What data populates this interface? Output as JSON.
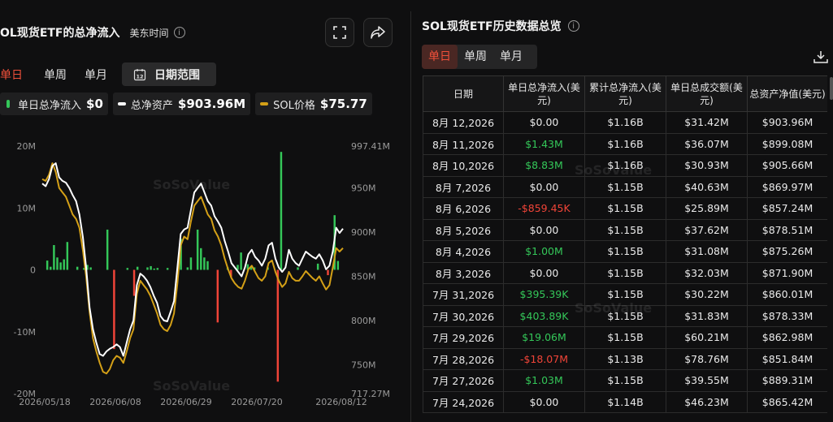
{
  "left": {
    "title": "OL现货ETF的总净流入",
    "timezone": "美东时间",
    "tabs": [
      "单日",
      "单周",
      "单月"
    ],
    "date_range_label": "日期范围",
    "date_range_icon_text": "12",
    "legend": [
      {
        "label": "单日总净流入",
        "value": "$0",
        "color": "#34c759"
      },
      {
        "label": "总净资产",
        "value": "$903.96M",
        "color": "#ffffff"
      },
      {
        "label": "SOL价格",
        "value": "$75.77",
        "color": "#d4a017"
      }
    ]
  },
  "right": {
    "title": "SOL现货ETF历史数据总览",
    "tabs": [
      "单日",
      "单周",
      "单月"
    ],
    "columns": [
      "日期",
      "单日总净流入(美元)",
      "累计总净流入(美元)",
      "单日总成交额(美元)",
      "总资产净值(美元)"
    ],
    "rows": [
      {
        "date": "8月 12,2026",
        "net": "$0.00",
        "net_sign": "zero",
        "cum": "$1.16B",
        "vol": "$31.42M",
        "nav": "$903.96M"
      },
      {
        "date": "8月 11,2026",
        "net": "$1.43M",
        "net_sign": "pos",
        "cum": "$1.16B",
        "vol": "$36.07M",
        "nav": "$899.08M"
      },
      {
        "date": "8月 10,2026",
        "net": "$8.83M",
        "net_sign": "pos",
        "cum": "$1.16B",
        "vol": "$30.93M",
        "nav": "$905.66M"
      },
      {
        "date": "8月 7,2026",
        "net": "$0.00",
        "net_sign": "zero",
        "cum": "$1.15B",
        "vol": "$40.63M",
        "nav": "$869.97M"
      },
      {
        "date": "8月 6,2026",
        "net": "-$859.45K",
        "net_sign": "neg",
        "cum": "$1.15B",
        "vol": "$25.89M",
        "nav": "$857.24M"
      },
      {
        "date": "8月 5,2026",
        "net": "$0.00",
        "net_sign": "zero",
        "cum": "$1.15B",
        "vol": "$37.62M",
        "nav": "$878.51M"
      },
      {
        "date": "8月 4,2026",
        "net": "$1.00M",
        "net_sign": "pos",
        "cum": "$1.15B",
        "vol": "$31.08M",
        "nav": "$875.26M"
      },
      {
        "date": "8月 3,2026",
        "net": "$0.00",
        "net_sign": "zero",
        "cum": "$1.15B",
        "vol": "$32.03M",
        "nav": "$871.90M"
      },
      {
        "date": "7月 31,2026",
        "net": "$395.39K",
        "net_sign": "pos",
        "cum": "$1.15B",
        "vol": "$30.22M",
        "nav": "$860.01M"
      },
      {
        "date": "7月 30,2026",
        "net": "$403.89K",
        "net_sign": "pos",
        "cum": "$1.15B",
        "vol": "$31.83M",
        "nav": "$878.33M"
      },
      {
        "date": "7月 29,2026",
        "net": "$19.06M",
        "net_sign": "pos",
        "cum": "$1.15B",
        "vol": "$60.21M",
        "nav": "$862.98M"
      },
      {
        "date": "7月 28,2026",
        "net": "-$18.07M",
        "net_sign": "neg",
        "cum": "$1.13B",
        "vol": "$78.76M",
        "nav": "$851.84M"
      },
      {
        "date": "7月 27,2026",
        "net": "$1.03M",
        "net_sign": "pos",
        "cum": "$1.15B",
        "vol": "$39.55M",
        "nav": "$889.31M"
      },
      {
        "date": "7月 24,2026",
        "net": "$0.00",
        "net_sign": "zero",
        "cum": "$1.14B",
        "vol": "$46.23M",
        "nav": "$865.42M"
      }
    ]
  },
  "watermark": "SoSoValue",
  "chart_data": {
    "type": "bar",
    "left_axis": {
      "ticks": [
        "20M",
        "10M",
        "0",
        "-10M",
        "-20M"
      ],
      "range": [
        -20,
        20
      ]
    },
    "right_axis": {
      "ticks": [
        "997.41M",
        "950M",
        "900M",
        "850M",
        "800M",
        "750M",
        "717.27M"
      ],
      "range": [
        717.27,
        997.41
      ]
    },
    "x_ticks": [
      "2026/05/18",
      "2026/06/08",
      "2026/06/29",
      "2026/07/20",
      "2026/08/12"
    ],
    "series": [
      {
        "name": "单日总净流入",
        "kind": "bar",
        "unit": "M",
        "values": [
          0,
          1.5,
          0.5,
          4,
          2,
          1.2,
          1.7,
          4.5,
          0,
          0,
          0.5,
          0,
          0.3,
          0.8,
          0.4,
          0,
          0,
          0,
          0,
          6.5,
          0,
          -12.8,
          0,
          0,
          0,
          0.3,
          0,
          -4.2,
          0.5,
          0,
          0,
          0.4,
          0.6,
          0.2,
          0.3,
          0,
          0,
          0.3,
          0,
          0,
          0,
          5,
          0,
          0.4,
          2,
          0,
          6.5,
          3.5,
          2,
          1.4,
          0,
          0,
          -8.5,
          0,
          0,
          0.4,
          -1.2,
          0,
          0.8,
          2.8,
          0,
          0.9,
          0.5,
          0.4,
          0,
          0,
          0,
          0.4,
          0,
          0,
          -18.07,
          19.06,
          0,
          0,
          0,
          0,
          0.4,
          0,
          0,
          0,
          0,
          0,
          1.0,
          0,
          0,
          -0.86,
          0,
          8.83,
          1.43,
          0
        ]
      },
      {
        "name": "总净资产",
        "kind": "line",
        "unit": "M",
        "values": [
          955,
          952,
          960,
          975,
          978,
          962,
          958,
          956,
          950,
          942,
          935,
          920,
          895,
          860,
          815,
          790,
          775,
          762,
          760,
          765,
          768,
          770,
          773,
          770,
          760,
          775,
          790,
          800,
          840,
          853,
          850,
          845,
          838,
          828,
          820,
          805,
          800,
          799,
          810,
          822,
          860,
          898,
          903,
          905,
          925,
          945,
          950,
          955,
          945,
          935,
          930,
          918,
          912,
          905,
          890,
          878,
          865,
          860,
          855,
          850,
          860,
          875,
          880,
          872,
          868,
          862,
          870,
          885,
          888,
          870,
          860,
          855,
          860,
          880,
          870,
          865,
          862,
          870,
          878,
          875,
          872,
          870,
          875,
          868,
          858,
          862,
          878,
          905,
          899,
          904
        ]
      },
      {
        "name": "SOL价格",
        "kind": "line",
        "unit": "USD",
        "values": [
          0.0,
          0.0,
          0.0,
          0.0
        ]
      }
    ],
    "sol_price_curve": [
      960,
      958,
      965,
      978,
      968,
      950,
      945,
      940,
      930,
      920,
      915,
      905,
      880,
      850,
      810,
      780,
      765,
      752,
      742,
      740,
      745,
      755,
      760,
      758,
      752,
      765,
      780,
      790,
      830,
      845,
      840,
      835,
      828,
      818,
      808,
      795,
      790,
      788,
      795,
      808,
      842,
      885,
      895,
      892,
      912,
      930,
      935,
      940,
      930,
      920,
      915,
      902,
      895,
      885,
      870,
      858,
      848,
      842,
      838,
      836,
      845,
      858,
      862,
      855,
      848,
      845,
      850,
      865,
      868,
      855,
      845,
      838,
      842,
      855,
      848,
      845,
      845,
      850,
      856,
      852,
      848,
      845,
      850,
      842,
      835,
      840,
      860,
      882,
      878,
      882
    ],
    "legend_placement": "top",
    "grid": false
  }
}
